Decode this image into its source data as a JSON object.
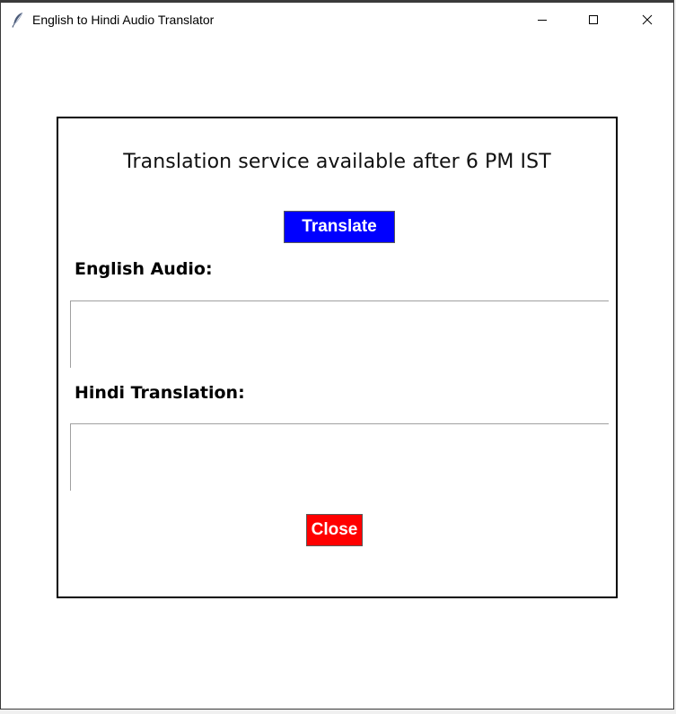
{
  "window": {
    "title": "English to Hindi Audio Translator",
    "icon": "feather-icon"
  },
  "titlebar_buttons": {
    "minimize_icon": "minimize-icon",
    "maximize_icon": "maximize-icon",
    "close_icon": "close-icon"
  },
  "main": {
    "notice": "Translation service available after 6 PM IST",
    "translate_button": "Translate",
    "english_label": "English Audio:",
    "english_text": "",
    "hindi_label": "Hindi Translation:",
    "hindi_text": "",
    "close_button": "Close"
  },
  "colors": {
    "translate_button_bg": "#0000ff",
    "close_button_bg": "#ff0000",
    "button_text": "#ffffff"
  }
}
